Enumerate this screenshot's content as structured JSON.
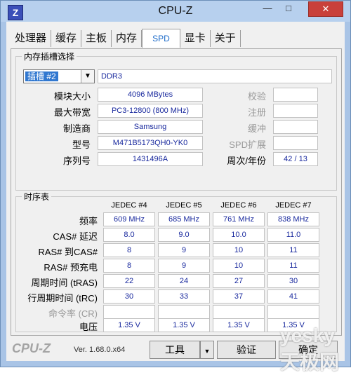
{
  "window": {
    "title": "CPU-Z",
    "icon": "Z"
  },
  "tabs": [
    {
      "label": "处理器"
    },
    {
      "label": "缓存"
    },
    {
      "label": "主板"
    },
    {
      "label": "内存"
    },
    {
      "label": "SPD"
    },
    {
      "label": "显卡"
    },
    {
      "label": "关于"
    }
  ],
  "slot_group": {
    "legend": "内存插槽选择",
    "selected_slot": "插槽 #2",
    "module_type": "DDR3",
    "rows": [
      {
        "label": "模块大小",
        "value": "4096 MBytes",
        "rlabel": "校验",
        "rvalue": ""
      },
      {
        "label": "最大带宽",
        "value": "PC3-12800 (800 MHz)",
        "rlabel": "注册",
        "rvalue": ""
      },
      {
        "label": "制造商",
        "value": "Samsung",
        "rlabel": "缓冲",
        "rvalue": ""
      },
      {
        "label": "型号",
        "value": "M471B5173QH0-YK0",
        "rlabel": "SPD扩展",
        "rvalue": ""
      },
      {
        "label": "序列号",
        "value": "1431496A",
        "rlabel": "周次/年份",
        "rvalue": "42 / 13"
      }
    ]
  },
  "timings_group": {
    "legend": "时序表",
    "columns": [
      "JEDEC #4",
      "JEDEC #5",
      "JEDEC #6",
      "JEDEC #7"
    ],
    "rows": [
      {
        "label": "频率",
        "values": [
          "609 MHz",
          "685 MHz",
          "761 MHz",
          "838 MHz"
        ]
      },
      {
        "label": "CAS# 延迟",
        "values": [
          "8.0",
          "9.0",
          "10.0",
          "11.0"
        ]
      },
      {
        "label": "RAS# 到CAS#",
        "values": [
          "8",
          "9",
          "10",
          "11"
        ]
      },
      {
        "label": "RAS# 预充电",
        "values": [
          "8",
          "9",
          "10",
          "11"
        ]
      },
      {
        "label": "周期时间 (tRAS)",
        "values": [
          "22",
          "24",
          "27",
          "30"
        ]
      },
      {
        "label": "行周期时间 (tRC)",
        "values": [
          "30",
          "33",
          "37",
          "41"
        ]
      },
      {
        "label": "命令率 (CR)",
        "values": [
          "",
          "",
          "",
          ""
        ]
      },
      {
        "label": "电压",
        "values": [
          "1.35 V",
          "1.35 V",
          "1.35 V",
          "1.35 V"
        ]
      }
    ]
  },
  "footer": {
    "logo": "CPU-Z",
    "version": "Ver. 1.68.0.x64",
    "tools_label": "工具",
    "validate_label": "验证",
    "ok_label": "确定"
  },
  "watermark": "yesky 天极网"
}
